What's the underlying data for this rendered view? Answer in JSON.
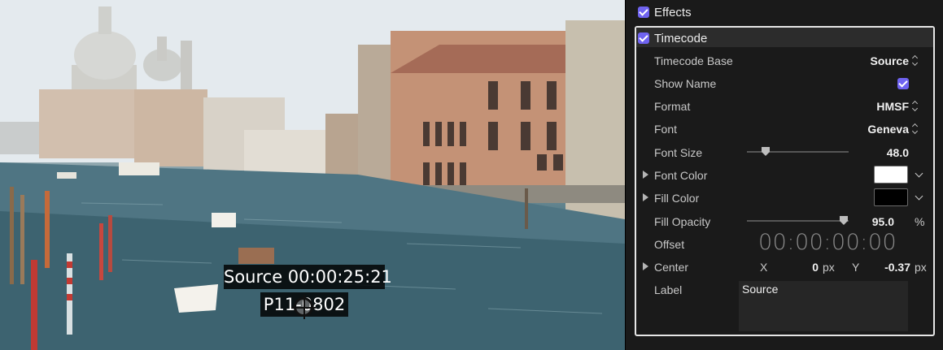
{
  "viewer": {
    "overlay_line1": "Source 00:00:25:21",
    "overlay_line2": "P11-0802"
  },
  "inspector": {
    "effects_label": "Effects",
    "effects_checked": true,
    "timecode": {
      "title": "Timecode",
      "enabled": true,
      "rows": {
        "timecode_base": {
          "label": "Timecode Base",
          "value": "Source"
        },
        "show_name": {
          "label": "Show Name",
          "checked": true
        },
        "format": {
          "label": "Format",
          "value": "HMSF"
        },
        "font": {
          "label": "Font",
          "value": "Geneva"
        },
        "font_size": {
          "label": "Font Size",
          "value": "48.0",
          "slider_fraction": 0.18
        },
        "font_color": {
          "label": "Font Color",
          "color": "#ffffff"
        },
        "fill_color": {
          "label": "Fill Color",
          "color": "#000000"
        },
        "fill_opacity": {
          "label": "Fill Opacity",
          "value": "95.0",
          "unit": "%",
          "slider_fraction": 0.95
        },
        "offset": {
          "label": "Offset",
          "value": "00:00:00:00"
        },
        "center": {
          "label": "Center",
          "x_label": "X",
          "x_value": "0",
          "x_unit": "px",
          "y_label": "Y",
          "y_value": "-0.37",
          "y_unit": "px"
        },
        "label": {
          "label": "Label",
          "value": "Source"
        }
      }
    }
  },
  "colors": {
    "accent": "#6f63f0",
    "panel_bg": "#1a1a1a"
  }
}
